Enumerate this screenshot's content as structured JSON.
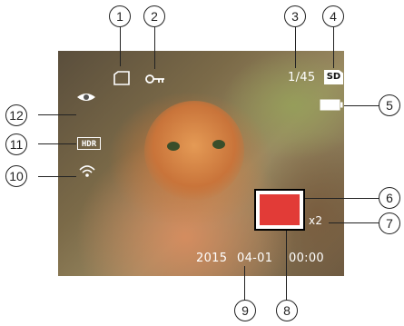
{
  "osd": {
    "image_count": "1/45",
    "date": "2015",
    "month_day": "04-01",
    "time": "00:00",
    "zoom": "x2",
    "sd_label": "SD",
    "hdr_label": "HDR"
  },
  "icons": {
    "file": "file-icon",
    "protect": "key-icon",
    "card": "sd-card-icon",
    "battery": "battery-icon",
    "face": "eye-icon",
    "hdr": "hdr-icon",
    "wifi": "wifi-icon",
    "focus": "focus-frame-icon"
  },
  "callouts": [
    "1",
    "2",
    "3",
    "4",
    "5",
    "6",
    "7",
    "8",
    "9",
    "10",
    "11",
    "12"
  ],
  "colors": {
    "focus_fill": "#e23b37",
    "osd_text": "#ffffff"
  }
}
